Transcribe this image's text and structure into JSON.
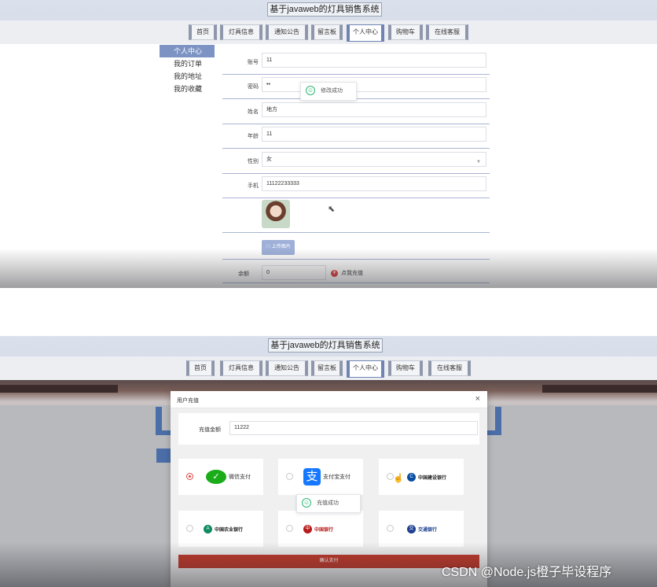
{
  "site": {
    "title": "基于javaweb的灯具销售系统"
  },
  "nav": {
    "items": [
      "首页",
      "灯具信息",
      "通知公告",
      "留言板",
      "个人中心",
      "购物车",
      "在线客服"
    ],
    "active_index": 4
  },
  "sidebar": {
    "items": [
      "个人中心",
      "我的订单",
      "我的地址",
      "我的收藏"
    ],
    "active_index": 0
  },
  "profile": {
    "account": {
      "label": "账号",
      "value": "11"
    },
    "password": {
      "label": "密码",
      "value": "••"
    },
    "name": {
      "label": "姓名",
      "value": "地方"
    },
    "age": {
      "label": "年龄",
      "value": "11"
    },
    "gender": {
      "label": "性别",
      "value": "女"
    },
    "phone": {
      "label": "手机",
      "value": "11122233333"
    },
    "upload_label": "上传图片",
    "balance": {
      "label": "余额",
      "value": "0"
    },
    "recharge_link": "点我充值",
    "toast": "修改成功"
  },
  "recharge_modal": {
    "title": "用户充值",
    "close": "×",
    "amount": {
      "label": "充值金额",
      "value": "11222"
    },
    "payments": [
      {
        "name": "微信支付",
        "checked": true,
        "color": "#1aad19"
      },
      {
        "name": "支付宝支付",
        "checked": false,
        "color": "#1677ff"
      },
      {
        "name": "中国建设银行",
        "checked": false,
        "color": "#0a4ea2"
      },
      {
        "name": "中国农业银行",
        "checked": false,
        "color": "#0f8a63"
      },
      {
        "name": "中国银行",
        "checked": false,
        "color": "#b71c1c"
      },
      {
        "name": "交通银行",
        "checked": false,
        "color": "#1d3f8f"
      }
    ],
    "toast": "充值成功",
    "confirm_label": "确认支付"
  },
  "watermark": "CSDN @Node.js橙子毕设程序"
}
